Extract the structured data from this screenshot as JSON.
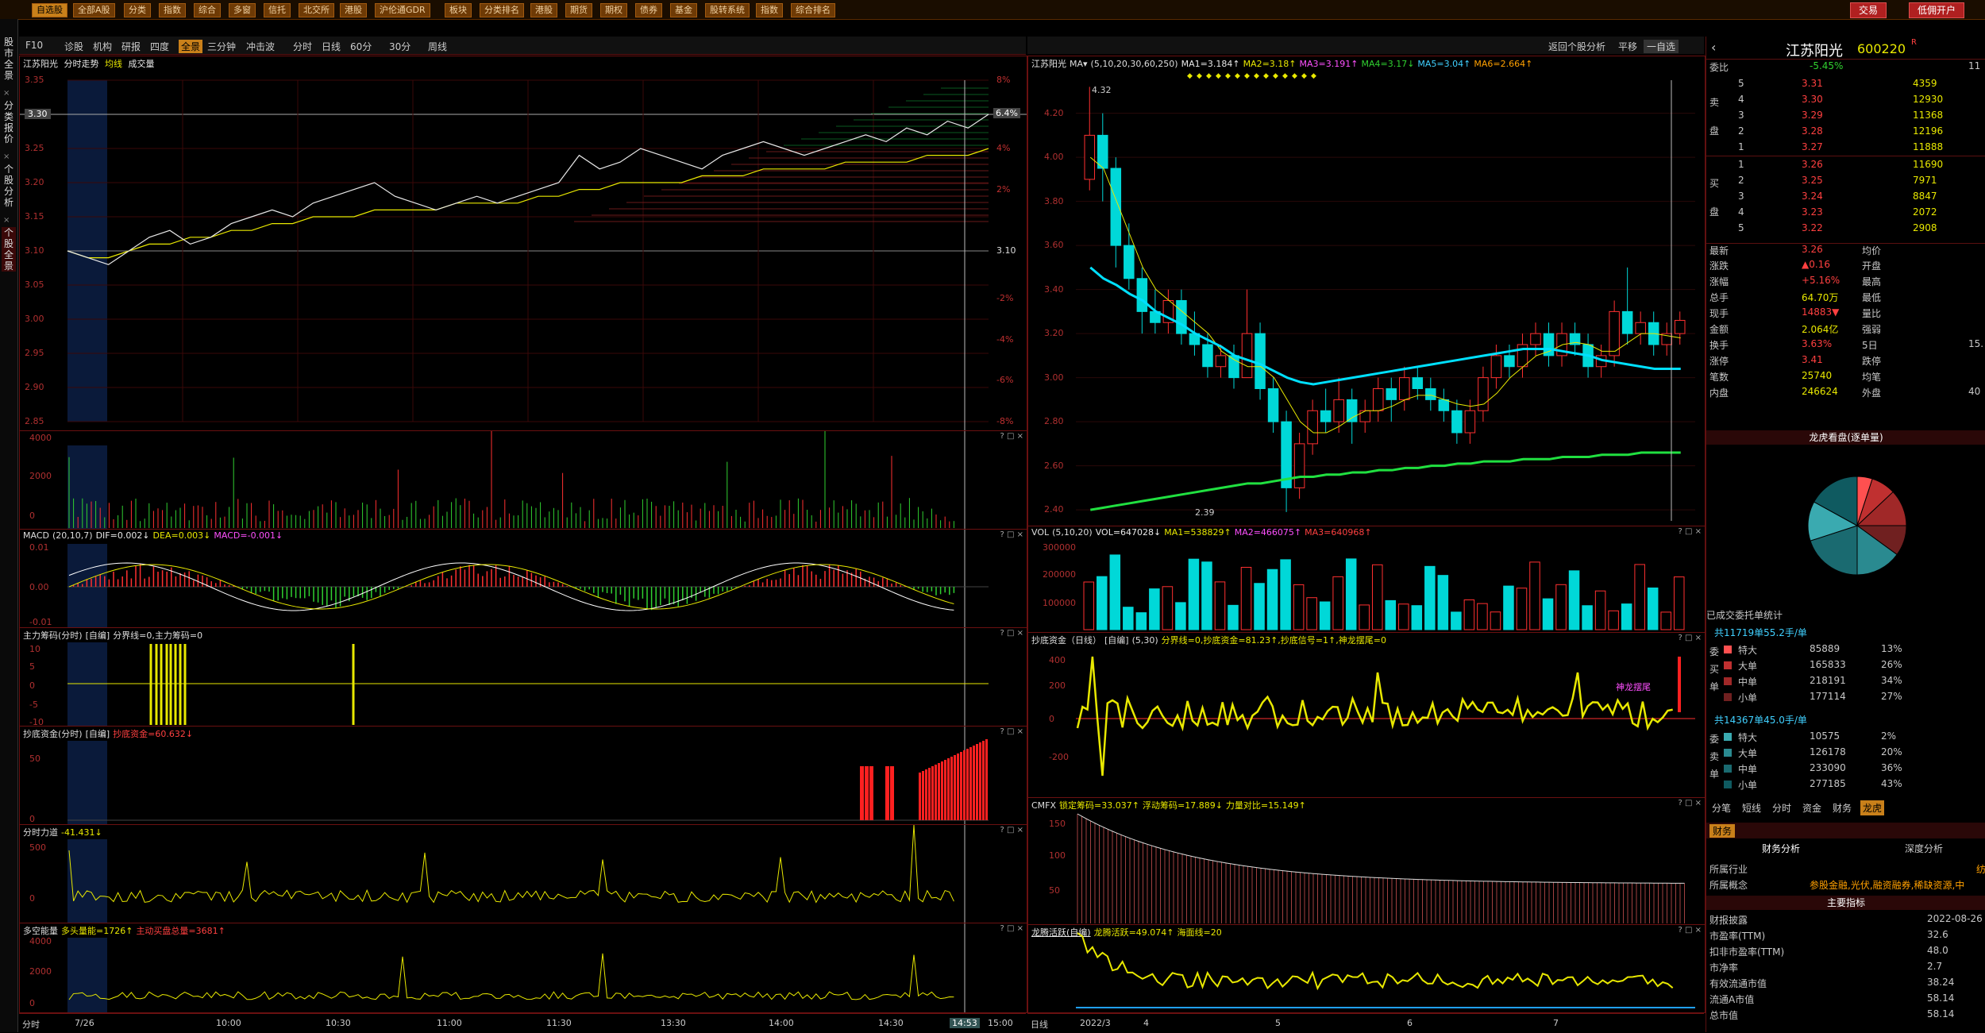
{
  "topbar": {
    "items": [
      "自选股",
      "全部A股",
      "分类",
      "指数",
      "综合",
      "多窗",
      "信托",
      "北交所",
      "港股",
      "沪伦通GDR",
      "板块",
      "分类排名",
      "港股",
      "期货",
      "期权",
      "债券",
      "基金",
      "股转系统",
      "指数",
      "综合排名"
    ],
    "trade_btn": "交易",
    "margin_btn": "低佣开户"
  },
  "vtabs": [
    "股市全景",
    "分类报价",
    "个股分析",
    "个股全景"
  ],
  "toolbar_left": [
    "F10",
    "诊股",
    "机构",
    "研报",
    "四度",
    "全景",
    "三分钟",
    "冲击波",
    "分时",
    "日线",
    "60分",
    "30分",
    "周线"
  ],
  "toolbar_left_active": "全景",
  "toolbar_right": {
    "back": "返回个股分析",
    "flat": "平移",
    "select": "一自选"
  },
  "intraday": {
    "title": "江苏阳光",
    "sub1": "分时走势",
    "sub2": "均线",
    "sub3": "成交量",
    "yleft": [
      "3.35",
      "3.30",
      "3.25",
      "3.20",
      "3.15",
      "3.10",
      "3.05",
      "3.00",
      "2.95",
      "2.90",
      "2.85"
    ],
    "yright": [
      "8%",
      "6%",
      "4%",
      "2%",
      "3.10",
      "-2%",
      "-4%",
      "-6%",
      "-8%"
    ],
    "current_price": "3.30",
    "current_pct": "6.4%",
    "price_series": [
      3.1,
      3.09,
      3.08,
      3.1,
      3.12,
      3.13,
      3.11,
      3.12,
      3.14,
      3.15,
      3.16,
      3.15,
      3.17,
      3.18,
      3.19,
      3.2,
      3.18,
      3.17,
      3.16,
      3.17,
      3.18,
      3.17,
      3.18,
      3.19,
      3.2,
      3.24,
      3.22,
      3.23,
      3.25,
      3.24,
      3.23,
      3.22,
      3.24,
      3.25,
      3.26,
      3.25,
      3.24,
      3.25,
      3.26,
      3.27,
      3.26,
      3.28,
      3.27,
      3.29,
      3.28,
      3.3
    ],
    "avg_series": [
      3.1,
      3.09,
      3.09,
      3.1,
      3.11,
      3.11,
      3.12,
      3.12,
      3.13,
      3.13,
      3.14,
      3.14,
      3.15,
      3.15,
      3.15,
      3.16,
      3.16,
      3.16,
      3.16,
      3.17,
      3.17,
      3.17,
      3.17,
      3.18,
      3.18,
      3.19,
      3.19,
      3.2,
      3.2,
      3.2,
      3.2,
      3.21,
      3.21,
      3.21,
      3.22,
      3.22,
      3.22,
      3.22,
      3.23,
      3.23,
      3.23,
      3.23,
      3.24,
      3.24,
      3.24,
      3.25
    ]
  },
  "vol_panel": {
    "yl": [
      "4000",
      "2000",
      "0"
    ]
  },
  "macd_panel": {
    "title": "MACD",
    "params": "(20,10,7)",
    "dif": "DIF=0.002↓",
    "dea": "DEA=0.003↓",
    "macd": "MACD=-0.001↓",
    "yl": [
      "0.01",
      "0.00",
      "-0.01"
    ]
  },
  "zlcm_panel": {
    "title": "主力筹码(分时)",
    "mode": "[自编]",
    "line": "分界线=0,主力筹码=0",
    "yl": [
      "10",
      "5",
      "0",
      "-5",
      "-10"
    ]
  },
  "cdzj_panel": {
    "title": "抄底资金(分时)",
    "mode": "[自编]",
    "line": "抄底资金=60.632↓",
    "yl": [
      "50",
      "0"
    ]
  },
  "fsld_panel": {
    "title": "分时力道",
    "val": "-41.431↓",
    "yl": [
      "500",
      "0"
    ]
  },
  "dkln_panel": {
    "title": "多空能量",
    "l1": "多头量能=1726↑",
    "l2": "主动买盘总量=3681↑",
    "yl": [
      "4000",
      "2000",
      "0"
    ]
  },
  "intraday_x": [
    "分时",
    "7/26",
    "10:00",
    "10:30",
    "11:00",
    "11:30",
    "13:30",
    "14:00",
    "14:30",
    "14:53",
    "15:00"
  ],
  "daily": {
    "title": "江苏阳光",
    "ma_params": "(5,10,20,30,60,250)",
    "ma1": "MA1=3.184↑",
    "ma2": "MA2=3.18↑",
    "ma3": "MA3=3.191↑",
    "ma4": "MA4=3.17↓",
    "ma5": "MA5=3.04↑",
    "ma6": "MA6=2.664↑",
    "yl": [
      "4.20",
      "4.00",
      "3.80",
      "3.60",
      "3.40",
      "3.20",
      "3.00",
      "2.80",
      "2.60",
      "2.40"
    ],
    "high_label": "4.32",
    "low_label": "2.39",
    "candles": [
      [
        3.9,
        4.1,
        3.85,
        4.32
      ],
      [
        4.1,
        3.95,
        3.8,
        4.2
      ],
      [
        3.95,
        3.6,
        3.5,
        4.0
      ],
      [
        3.6,
        3.45,
        3.4,
        3.7
      ],
      [
        3.45,
        3.3,
        3.2,
        3.5
      ],
      [
        3.3,
        3.25,
        3.2,
        3.4
      ],
      [
        3.25,
        3.35,
        3.2,
        3.4
      ],
      [
        3.35,
        3.2,
        3.15,
        3.4
      ],
      [
        3.2,
        3.15,
        3.1,
        3.3
      ],
      [
        3.15,
        3.05,
        3.0,
        3.2
      ],
      [
        3.05,
        3.1,
        3.0,
        3.15
      ],
      [
        3.1,
        3.0,
        2.95,
        3.15
      ],
      [
        3.0,
        3.2,
        3.0,
        3.4
      ],
      [
        3.2,
        2.95,
        2.9,
        3.25
      ],
      [
        2.95,
        2.8,
        2.75,
        3.0
      ],
      [
        2.8,
        2.5,
        2.39,
        2.85
      ],
      [
        2.5,
        2.7,
        2.45,
        2.75
      ],
      [
        2.7,
        2.85,
        2.65,
        2.9
      ],
      [
        2.85,
        2.8,
        2.75,
        2.95
      ],
      [
        2.8,
        2.9,
        2.75,
        3.0
      ],
      [
        2.9,
        2.8,
        2.7,
        2.95
      ],
      [
        2.8,
        2.85,
        2.75,
        2.9
      ],
      [
        2.85,
        2.95,
        2.8,
        3.0
      ],
      [
        2.95,
        2.9,
        2.8,
        3.0
      ],
      [
        2.9,
        3.0,
        2.85,
        3.05
      ],
      [
        3.0,
        2.95,
        2.9,
        3.05
      ],
      [
        2.95,
        2.9,
        2.85,
        3.0
      ],
      [
        2.9,
        2.85,
        2.8,
        2.95
      ],
      [
        2.85,
        2.75,
        2.7,
        2.9
      ],
      [
        2.75,
        2.85,
        2.7,
        2.9
      ],
      [
        2.85,
        3.0,
        2.8,
        3.05
      ],
      [
        3.0,
        3.1,
        2.95,
        3.15
      ],
      [
        3.1,
        3.05,
        3.0,
        3.15
      ],
      [
        3.05,
        3.15,
        3.0,
        3.2
      ],
      [
        3.15,
        3.2,
        3.1,
        3.25
      ],
      [
        3.2,
        3.1,
        3.05,
        3.25
      ],
      [
        3.1,
        3.2,
        3.05,
        3.25
      ],
      [
        3.2,
        3.15,
        3.1,
        3.25
      ],
      [
        3.15,
        3.05,
        3.0,
        3.2
      ],
      [
        3.05,
        3.1,
        3.0,
        3.15
      ],
      [
        3.1,
        3.3,
        3.05,
        3.35
      ],
      [
        3.3,
        3.2,
        3.15,
        3.5
      ],
      [
        3.2,
        3.25,
        3.15,
        3.3
      ],
      [
        3.25,
        3.15,
        3.1,
        3.3
      ],
      [
        3.15,
        3.2,
        3.1,
        3.25
      ],
      [
        3.2,
        3.26,
        3.15,
        3.3
      ]
    ],
    "ma_short": [
      4.0,
      3.95,
      3.8,
      3.65,
      3.5,
      3.4,
      3.35,
      3.3,
      3.25,
      3.2,
      3.12,
      3.08,
      3.05,
      3.05,
      3.0,
      2.9,
      2.8,
      2.75,
      2.75,
      2.78,
      2.82,
      2.85,
      2.85,
      2.87,
      2.9,
      2.92,
      2.92,
      2.9,
      2.88,
      2.87,
      2.88,
      2.93,
      3.0,
      3.05,
      3.1,
      3.12,
      3.15,
      3.16,
      3.15,
      3.12,
      3.12,
      3.16,
      3.2,
      3.2,
      3.19,
      3.18
    ],
    "ma_60": [
      3.5,
      3.45,
      3.42,
      3.38,
      3.35,
      3.3,
      3.27,
      3.24,
      3.2,
      3.17,
      3.14,
      3.1,
      3.08,
      3.06,
      3.03,
      3.0,
      2.98,
      2.97,
      2.98,
      2.99,
      3.0,
      3.01,
      3.02,
      3.03,
      3.04,
      3.05,
      3.06,
      3.07,
      3.08,
      3.09,
      3.1,
      3.11,
      3.12,
      3.13,
      3.13,
      3.13,
      3.12,
      3.11,
      3.1,
      3.08,
      3.07,
      3.06,
      3.05,
      3.04,
      3.04,
      3.04
    ],
    "ma_250": [
      2.4,
      2.41,
      2.42,
      2.43,
      2.44,
      2.45,
      2.46,
      2.47,
      2.48,
      2.49,
      2.5,
      2.51,
      2.52,
      2.52,
      2.53,
      2.54,
      2.55,
      2.55,
      2.56,
      2.56,
      2.57,
      2.57,
      2.58,
      2.58,
      2.59,
      2.59,
      2.6,
      2.6,
      2.61,
      2.61,
      2.62,
      2.62,
      2.62,
      2.63,
      2.63,
      2.63,
      2.64,
      2.64,
      2.64,
      2.65,
      2.65,
      2.65,
      2.66,
      2.66,
      2.66,
      2.66
    ]
  },
  "dvol_panel": {
    "title": "VOL",
    "params": "(5,10,20)",
    "vol": "VOL=647028↓",
    "ma1": "MA1=538829↑",
    "ma2": "MA2=466075↑",
    "ma3": "MA3=640968↑",
    "yl": [
      "300000",
      "200000",
      "100000"
    ]
  },
  "cdzj_daily": {
    "title": "抄底资金（日线）",
    "mode": "[自编]",
    "params": "(5,30)",
    "line": "分界线=0,抄底资金=81.23↑,抄底信号=1↑,神龙摆尾=0",
    "yl": [
      "400",
      "200",
      "0",
      "-200"
    ],
    "tag": "神龙摆尾"
  },
  "cmfx_panel": {
    "title": "CMFX",
    "l1": "锁定筹码=33.037↑",
    "l2": "浮动筹码=17.889↓",
    "l3": "力量对比=15.149↑",
    "yl": [
      "150",
      "100",
      "50"
    ]
  },
  "lthy_panel": {
    "title": "龙腾活跃(自编)",
    "l1": "龙腾活跃=49.074↑",
    "l2": "海面线=20"
  },
  "daily_x": [
    "日线",
    "2022/3",
    "4",
    "5",
    "6",
    "7"
  ],
  "quote": {
    "name": "江苏阳光",
    "code": "600220",
    "flag": "R",
    "webi_label": "委比",
    "webi_val": "-5.45%",
    "webi_right": "11",
    "asks": [
      [
        "5",
        "3.31",
        "4359"
      ],
      [
        "4",
        "3.30",
        "12930"
      ],
      [
        "3",
        "3.29",
        "11368"
      ],
      [
        "2",
        "3.28",
        "12196"
      ],
      [
        "1",
        "3.27",
        "11888"
      ]
    ],
    "bids": [
      [
        "1",
        "3.26",
        "11690"
      ],
      [
        "2",
        "3.25",
        "7971"
      ],
      [
        "3",
        "3.24",
        "8847"
      ],
      [
        "4",
        "3.23",
        "2072"
      ],
      [
        "5",
        "3.22",
        "2908"
      ]
    ],
    "side_ask": "卖盘",
    "side_bid": "买盘",
    "stats": [
      [
        "最新",
        "3.26",
        "均价",
        ""
      ],
      [
        "涨跌",
        "▲0.16",
        "开盘",
        ""
      ],
      [
        "涨幅",
        "+5.16%",
        "最高",
        ""
      ],
      [
        "总手",
        "64.70万",
        "最低",
        ""
      ],
      [
        "现手",
        "14883▼",
        "量比",
        ""
      ],
      [
        "金额",
        "2.064亿",
        "强弱",
        ""
      ],
      [
        "换手",
        "3.63%",
        "5日",
        "15."
      ],
      [
        "涨停",
        "3.41",
        "跌停",
        ""
      ],
      [
        "笔数",
        "25740",
        "均笔",
        ""
      ],
      [
        "内盘",
        "246624",
        "外盘",
        "40"
      ]
    ],
    "lhkp": "龙虎看盘(逐单量)",
    "pie": [
      0.05,
      0.08,
      0.12,
      0.1,
      0.15,
      0.2,
      0.13,
      0.17
    ],
    "entrust_title": "已成交委托单统计",
    "buy_total": "共11719单55.2手/单",
    "buy_rows": [
      [
        "特大",
        "85889",
        "13%"
      ],
      [
        "大单",
        "165833",
        "26%"
      ],
      [
        "中单",
        "218191",
        "34%"
      ],
      [
        "小单",
        "177114",
        "27%"
      ]
    ],
    "sell_total": "共14367单45.0手/单",
    "sell_rows": [
      [
        "特大",
        "10575",
        "2%"
      ],
      [
        "大单",
        "126178",
        "20%"
      ],
      [
        "中单",
        "233090",
        "36%"
      ],
      [
        "小单",
        "277185",
        "43%"
      ]
    ],
    "buy_side": "委买单",
    "sell_side": "委卖单",
    "tabs": [
      "分笔",
      "短线",
      "分时",
      "资金",
      "财务",
      "龙虎"
    ],
    "active_tab": "龙虎",
    "fin_tab": "财务",
    "fin_sub": [
      "财务分析",
      "深度分析"
    ],
    "industry_label": "所属行业",
    "industry_val": "纺",
    "concept_label": "所属概念",
    "concept_val": "参股金融,光伏,融资融券,稀缺资源,中",
    "main_index": "主要指标",
    "metrics": [
      [
        "财报披露",
        "2022-08-26"
      ],
      [
        "市盈率(TTM)",
        "32.6"
      ],
      [
        "扣非市盈率(TTM)",
        "48.0"
      ],
      [
        "市净率",
        "2.7"
      ],
      [
        "有效流通市值",
        "38.24"
      ],
      [
        "流通A市值",
        "58.14"
      ],
      [
        "总市值",
        "58.14"
      ]
    ]
  },
  "colors": {
    "up": "#ff3030",
    "down": "#00d8d8",
    "price": "#e0e0e0",
    "avg": "#e8e800",
    "border": "#6a1010"
  }
}
